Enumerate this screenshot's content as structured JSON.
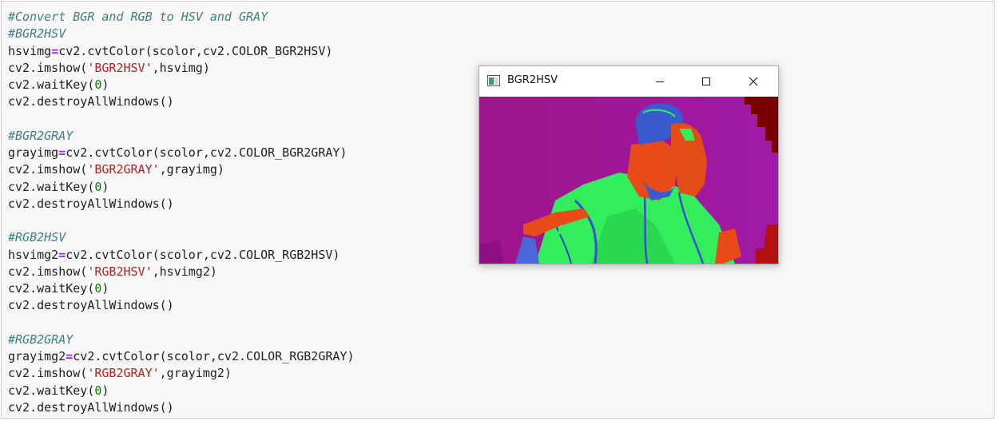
{
  "notebook": {
    "lines": [
      [
        {
          "t": "#Convert BGR and RGB to HSV and GRAY",
          "c": "comment"
        }
      ],
      [
        {
          "t": "#BGR2HSV",
          "c": "comment"
        }
      ],
      [
        {
          "t": "hsvimg"
        },
        {
          "t": "=",
          "c": "op"
        },
        {
          "t": "cv2.cvtColor(scolor,cv2.COLOR_BGR2HSV)"
        }
      ],
      [
        {
          "t": "cv2.imshow("
        },
        {
          "t": "'BGR2HSV'",
          "c": "str"
        },
        {
          "t": ",hsvimg)"
        }
      ],
      [
        {
          "t": "cv2.waitKey("
        },
        {
          "t": "0",
          "c": "num"
        },
        {
          "t": ")"
        }
      ],
      [
        {
          "t": "cv2.destroyAllWindows()"
        }
      ],
      [
        {
          "t": ""
        }
      ],
      [
        {
          "t": "#BGR2GRAY",
          "c": "comment"
        }
      ],
      [
        {
          "t": "grayimg"
        },
        {
          "t": "=",
          "c": "op"
        },
        {
          "t": "cv2.cvtColor(scolor,cv2.COLOR_BGR2GRAY)"
        }
      ],
      [
        {
          "t": "cv2.imshow("
        },
        {
          "t": "'BGR2GRAY'",
          "c": "str"
        },
        {
          "t": ",grayimg)"
        }
      ],
      [
        {
          "t": "cv2.waitKey("
        },
        {
          "t": "0",
          "c": "num"
        },
        {
          "t": ")"
        }
      ],
      [
        {
          "t": "cv2.destroyAllWindows()"
        }
      ],
      [
        {
          "t": ""
        }
      ],
      [
        {
          "t": "#RGB2HSV",
          "c": "comment"
        }
      ],
      [
        {
          "t": "hsvimg2"
        },
        {
          "t": "=",
          "c": "op"
        },
        {
          "t": "cv2.cvtColor(scolor,cv2.COLOR_RGB2HSV)"
        }
      ],
      [
        {
          "t": "cv2.imshow("
        },
        {
          "t": "'RGB2HSV'",
          "c": "str"
        },
        {
          "t": ",hsvimg2)"
        }
      ],
      [
        {
          "t": "cv2.waitKey("
        },
        {
          "t": "0",
          "c": "num"
        },
        {
          "t": ")"
        }
      ],
      [
        {
          "t": "cv2.destroyAllWindows()"
        }
      ],
      [
        {
          "t": ""
        }
      ],
      [
        {
          "t": "#RGB2GRAY",
          "c": "comment"
        }
      ],
      [
        {
          "t": "grayimg2"
        },
        {
          "t": "=",
          "c": "op"
        },
        {
          "t": "cv2.cvtColor(scolor,cv2.COLOR_RGB2GRAY)"
        }
      ],
      [
        {
          "t": "cv2.imshow("
        },
        {
          "t": "'RGB2GRAY'",
          "c": "str"
        },
        {
          "t": ",grayimg2)"
        }
      ],
      [
        {
          "t": "cv2.waitKey("
        },
        {
          "t": "0",
          "c": "num"
        },
        {
          "t": ")"
        }
      ],
      [
        {
          "t": "cv2.destroyAllWindows()"
        }
      ]
    ]
  },
  "window": {
    "title": "BGR2HSV",
    "controls": [
      "minimize-icon",
      "maximize-icon",
      "close-icon"
    ],
    "image": {
      "description_icon": "hsv-converted-photo",
      "colors": {
        "background": "#9c1290",
        "skin": "#e8501c",
        "shirt": "#33f05a",
        "hair": "#3a5bd0",
        "dark_corner": "#7a0000"
      }
    }
  },
  "theme": {
    "comment": "#408080",
    "operator": "#aa22ff",
    "string": "#ba2121",
    "number": "#008800"
  }
}
